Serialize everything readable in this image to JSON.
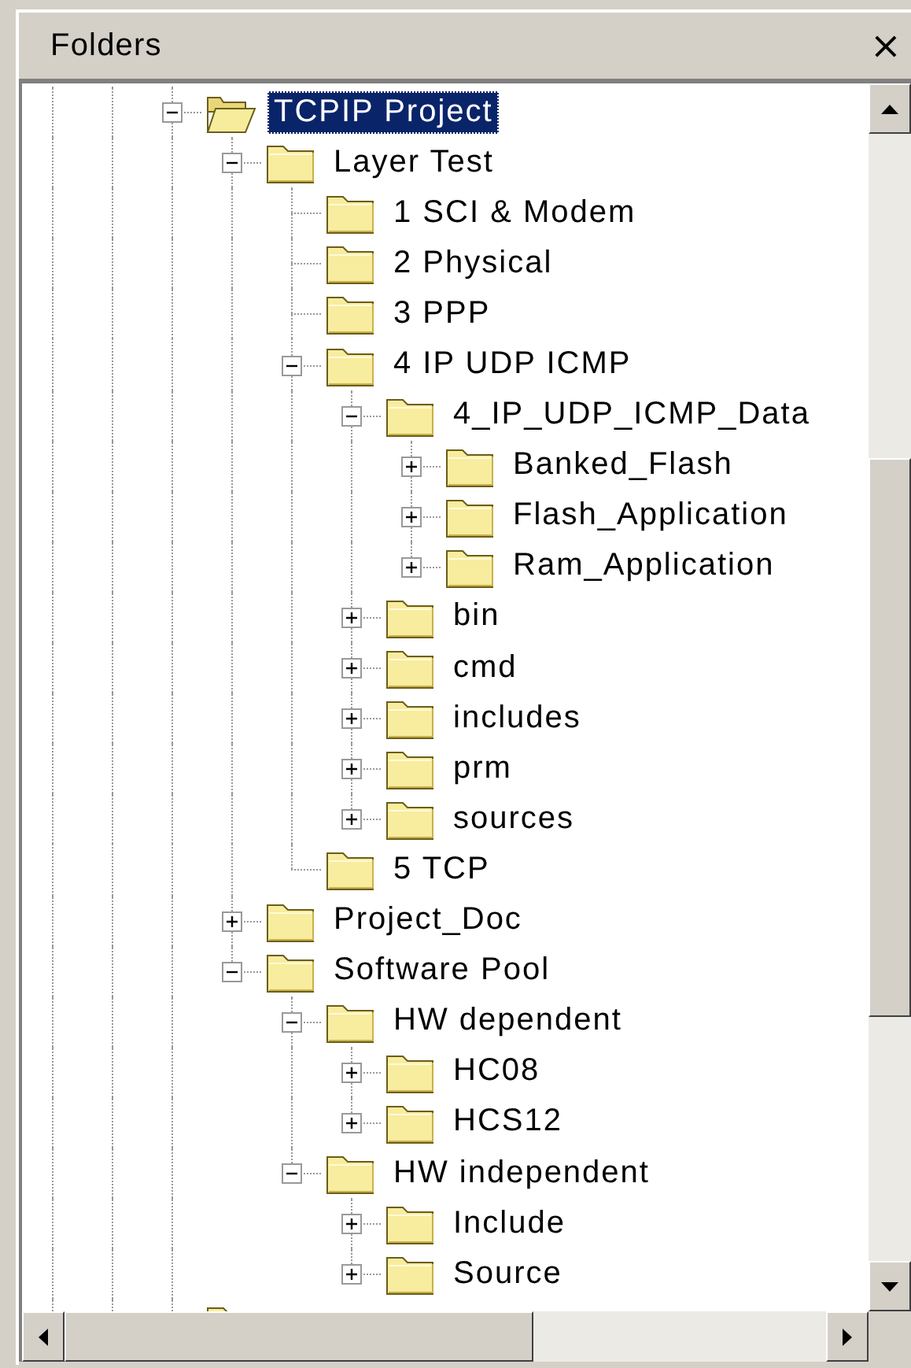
{
  "panel": {
    "title": "Folders",
    "close": "×"
  },
  "tree": {
    "nodes": [
      {
        "kind": "folder",
        "label": "TCPIP Project",
        "selected": true,
        "expanded": true,
        "children": [
          {
            "kind": "folder",
            "label": "Layer Test",
            "selected": false,
            "expanded": true,
            "children": [
              {
                "kind": "folder",
                "label": "1 SCI & Modem",
                "selected": false
              },
              {
                "kind": "folder",
                "label": "2 Physical",
                "selected": false
              },
              {
                "kind": "folder",
                "label": "3 PPP",
                "selected": false
              },
              {
                "kind": "folder",
                "label": "4 IP UDP ICMP",
                "selected": false,
                "expanded": true,
                "children": [
                  {
                    "kind": "folder",
                    "label": "4_IP_UDP_ICMP_Data",
                    "selected": false,
                    "expanded": true,
                    "children": [
                      {
                        "kind": "folder",
                        "label": "Banked_Flash",
                        "selected": false,
                        "expanded": false
                      },
                      {
                        "kind": "folder",
                        "label": "Flash_Application",
                        "selected": false,
                        "expanded": false
                      },
                      {
                        "kind": "folder",
                        "label": "Ram_Application",
                        "selected": false,
                        "expanded": false
                      }
                    ]
                  },
                  {
                    "kind": "folder",
                    "label": "bin",
                    "selected": false,
                    "expanded": false
                  },
                  {
                    "kind": "folder",
                    "label": "cmd",
                    "selected": false,
                    "expanded": false
                  },
                  {
                    "kind": "folder",
                    "label": "includes",
                    "selected": false,
                    "expanded": false
                  },
                  {
                    "kind": "folder",
                    "label": "prm",
                    "selected": false,
                    "expanded": false
                  },
                  {
                    "kind": "folder",
                    "label": "sources",
                    "selected": false,
                    "expanded": false
                  }
                ]
              },
              {
                "kind": "folder",
                "label": "5 TCP",
                "selected": false
              }
            ]
          },
          {
            "kind": "folder",
            "label": "Project_Doc",
            "selected": false,
            "expanded": false
          },
          {
            "kind": "folder",
            "label": "Software Pool",
            "selected": false,
            "expanded": true,
            "children": [
              {
                "kind": "folder",
                "label": "HW dependent",
                "selected": false,
                "expanded": true,
                "children": [
                  {
                    "kind": "folder",
                    "label": "HC08",
                    "selected": false,
                    "expanded": false
                  },
                  {
                    "kind": "folder",
                    "label": "HCS12",
                    "selected": false,
                    "expanded": false
                  }
                ]
              },
              {
                "kind": "folder",
                "label": "HW independent",
                "selected": false,
                "expanded": true,
                "children": [
                  {
                    "kind": "folder",
                    "label": "Include",
                    "selected": false,
                    "expanded": false
                  },
                  {
                    "kind": "folder",
                    "label": "Source",
                    "selected": false,
                    "expanded": false
                  }
                ]
              }
            ]
          }
        ]
      },
      {
        "kind": "partial"
      }
    ]
  }
}
